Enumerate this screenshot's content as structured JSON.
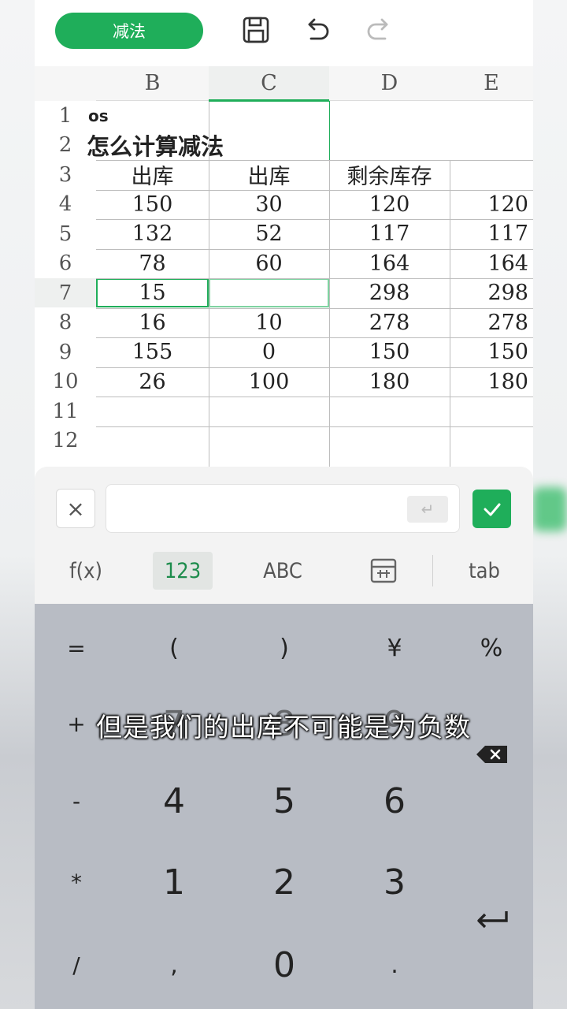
{
  "toolbar": {
    "title": "减法",
    "icons": [
      "save-icon",
      "undo-icon",
      "redo-icon"
    ]
  },
  "sheet": {
    "columns": [
      "B",
      "C",
      "D",
      "E"
    ],
    "selected_column": "C",
    "selected_row": "7",
    "row_numbers": [
      "1",
      "2",
      "3",
      "4",
      "5",
      "6",
      "7",
      "8",
      "9",
      "10",
      "11",
      "12"
    ],
    "rows": [
      {
        "n": "1",
        "B": "os",
        "C": "",
        "D": "",
        "E": ""
      },
      {
        "n": "2",
        "B": "怎么计算减法",
        "C": "",
        "D": "",
        "E": ""
      },
      {
        "n": "3",
        "B": "出库",
        "C": "出库",
        "D": "剩余库存",
        "E": ""
      },
      {
        "n": "4",
        "B": "150",
        "C": "30",
        "D": "120",
        "E": "120"
      },
      {
        "n": "5",
        "B": "132",
        "C": "52",
        "D": "117",
        "E": "117"
      },
      {
        "n": "6",
        "B": "78",
        "C": "60",
        "D": "164",
        "E": "164"
      },
      {
        "n": "7",
        "B": "15",
        "C": "",
        "D": "298",
        "E": "298"
      },
      {
        "n": "8",
        "B": "16",
        "C": "10",
        "D": "278",
        "E": "278"
      },
      {
        "n": "9",
        "B": "155",
        "C": "0",
        "D": "150",
        "E": "150"
      },
      {
        "n": "10",
        "B": "26",
        "C": "100",
        "D": "180",
        "E": "180"
      },
      {
        "n": "11",
        "B": "",
        "C": "",
        "D": "",
        "E": ""
      },
      {
        "n": "12",
        "B": "",
        "C": "",
        "D": "",
        "E": ""
      }
    ]
  },
  "formula_bar": {
    "cancel": "×",
    "value": "",
    "enter_glyph": "↵"
  },
  "modes": {
    "fx": "f(x)",
    "num": "123",
    "abc": "ABC",
    "tab": "tab"
  },
  "keyboard": {
    "row1": [
      "=",
      "(",
      ")",
      "¥",
      "%"
    ],
    "row2": [
      "+",
      "7",
      "8",
      "9"
    ],
    "row3": [
      "-",
      "4",
      "5",
      "6"
    ],
    "row4": [
      "*",
      "1",
      "2",
      "3"
    ],
    "row5": [
      "/",
      ",",
      "0",
      "."
    ]
  },
  "caption": "但是我们的出库不可能是为负数",
  "colors": {
    "accent": "#1fae5a"
  }
}
